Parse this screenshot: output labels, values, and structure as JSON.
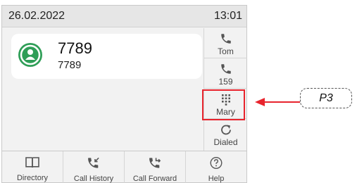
{
  "status_bar": {
    "date": "26.02.2022",
    "time": "13:01"
  },
  "contact": {
    "name": "7789",
    "number": "7789",
    "icon": "person-icon"
  },
  "side_keys": [
    {
      "label": "Tom",
      "icon": "phone-icon"
    },
    {
      "label": "159",
      "icon": "phone-icon"
    },
    {
      "label": "Mary",
      "icon": "keypad-icon"
    },
    {
      "label": "Dialed",
      "icon": "redial-icon"
    }
  ],
  "bottom_keys": [
    {
      "label": "Directory",
      "icon": "book-icon"
    },
    {
      "label": "Call History",
      "icon": "call-history-icon"
    },
    {
      "label": "Call Forward",
      "icon": "call-forward-icon"
    },
    {
      "label": "Help",
      "icon": "help-icon"
    }
  ],
  "annotation": {
    "label": "P3",
    "color": "#e8242d"
  },
  "colors": {
    "accent": "#2f9e57",
    "highlight": "#e8242d",
    "icon": "#555555"
  }
}
